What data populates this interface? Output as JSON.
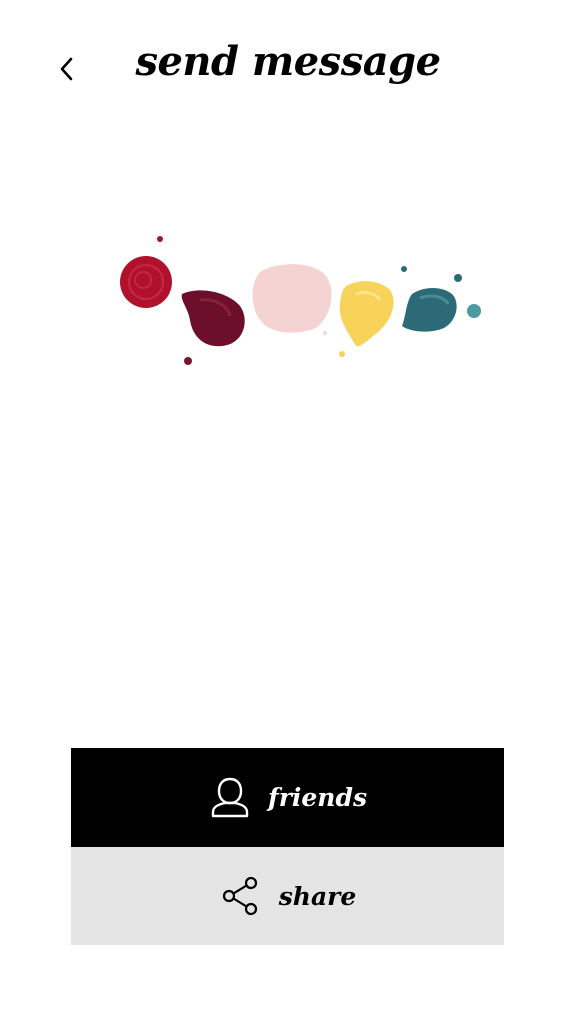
{
  "header": {
    "title": "send message",
    "back_icon": "chevron-left-icon"
  },
  "illustration": {
    "icon": "nail-polish-drops",
    "colors": {
      "red": "#b0122e",
      "burgundy": "#6b0f2a",
      "pink": "#f5d3d3",
      "yellow": "#f7d35a",
      "teal": "#2c6a78"
    }
  },
  "actions": {
    "friends": {
      "label": "friends",
      "icon": "person-icon",
      "background": "#000000",
      "text_color": "#ffffff"
    },
    "share": {
      "label": "share",
      "icon": "share-icon",
      "background": "#e4e4e4",
      "text_color": "#000000"
    }
  }
}
